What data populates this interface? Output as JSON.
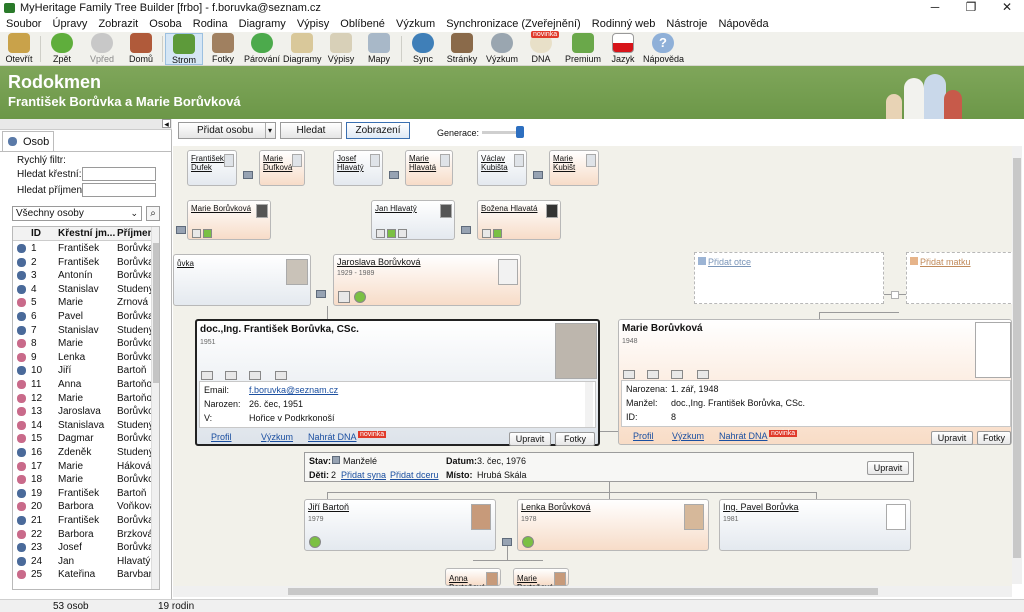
{
  "window": {
    "title": "MyHeritage Family Tree Builder [frbo] - f.boruvka@seznam.cz",
    "min": "─",
    "max": "❐",
    "close": "✕"
  },
  "menu": [
    "Soubor",
    "Úpravy",
    "Zobrazit",
    "Osoba",
    "Rodina",
    "Diagramy",
    "Výpisy",
    "Oblíbené",
    "Výzkum",
    "Synchronizace (Zveřejnění)",
    "Rodinný web",
    "Nástroje",
    "Nápověda"
  ],
  "toolbar": {
    "otevrit": "Otevřít",
    "zpet": "Zpět",
    "vpred": "Vpřed",
    "domu": "Domů",
    "strom": "Strom",
    "fotky": "Fotky",
    "parovani": "Párování",
    "diagramy": "Diagramy",
    "vypisy": "Výpisy",
    "mapy": "Mapy",
    "sync": "Sync",
    "stranky": "Stránky",
    "vyzkum": "Výzkum",
    "dna": "DNA",
    "novinka": "novinka",
    "premium": "Premium",
    "jazyk": "Jazyk",
    "napoveda": "Nápověda"
  },
  "header": {
    "title": "Rodokmen",
    "subtitle": "František Borůvka a Marie Borůvková"
  },
  "view": {
    "add_person": "Přidat osobu",
    "search": "Hledat",
    "display": "Zobrazení",
    "generations": "Generace:"
  },
  "left": {
    "tab": "Osob",
    "quick_filter": "Rychlý filtr:",
    "first_name": "Hledat křestní:",
    "last_name": "Hledat příjmení:",
    "all_persons": "Všechny osoby",
    "col_id": "ID",
    "col_first": "Křestní jm...",
    "col_last": "Příjmení"
  },
  "persons": [
    {
      "id": "1",
      "first": "František",
      "last": "Borůvka",
      "g": "m"
    },
    {
      "id": "2",
      "first": "František",
      "last": "Borůvka",
      "g": "m"
    },
    {
      "id": "3",
      "first": "Antonín",
      "last": "Borůvka",
      "g": "m"
    },
    {
      "id": "4",
      "first": "Stanislav",
      "last": "Studený",
      "g": "m"
    },
    {
      "id": "5",
      "first": "Marie",
      "last": "Zrnová",
      "g": "f"
    },
    {
      "id": "6",
      "first": "Pavel",
      "last": "Borůvka",
      "g": "m"
    },
    {
      "id": "7",
      "first": "Stanislav",
      "last": "Studený",
      "g": "m"
    },
    {
      "id": "8",
      "first": "Marie",
      "last": "Borůvkov",
      "g": "f"
    },
    {
      "id": "9",
      "first": "Lenka",
      "last": "Borůvkov",
      "g": "f"
    },
    {
      "id": "10",
      "first": "Jiří",
      "last": "Bartoň",
      "g": "m"
    },
    {
      "id": "11",
      "first": "Anna",
      "last": "Bartoňov",
      "g": "f"
    },
    {
      "id": "12",
      "first": "Marie",
      "last": "Bartoňov",
      "g": "f"
    },
    {
      "id": "13",
      "first": "Jaroslava",
      "last": "Borůvkov",
      "g": "f"
    },
    {
      "id": "14",
      "first": "Stanislava",
      "last": "Studený",
      "g": "f"
    },
    {
      "id": "15",
      "first": "Dagmar",
      "last": "Borůvkov",
      "g": "f"
    },
    {
      "id": "16",
      "first": "Zdeněk",
      "last": "Studený",
      "g": "m"
    },
    {
      "id": "17",
      "first": "Marie",
      "last": "Háková",
      "g": "f"
    },
    {
      "id": "18",
      "first": "Marie",
      "last": "Borůvkov",
      "g": "f"
    },
    {
      "id": "19",
      "first": "František",
      "last": "Bartoň",
      "g": "m"
    },
    {
      "id": "20",
      "first": "Barbora",
      "last": "Voňková",
      "g": "f"
    },
    {
      "id": "21",
      "first": "František",
      "last": "Borůvka",
      "g": "m"
    },
    {
      "id": "22",
      "first": "Barbora",
      "last": "Brzková",
      "g": "f"
    },
    {
      "id": "23",
      "first": "Josef",
      "last": "Borůvka",
      "g": "m"
    },
    {
      "id": "24",
      "first": "Jan",
      "last": "Hlavatý",
      "g": "m"
    },
    {
      "id": "25",
      "first": "Kateřina",
      "last": "Barvbar",
      "g": "f"
    }
  ],
  "tree": {
    "gg": [
      "František Dufek",
      "Marie Dufková",
      "Josef Hlavatý",
      "Marie Hlavatá",
      "Václav Kubišta",
      "Marie Kubišt"
    ],
    "gp": [
      "Marie Borůvková",
      "Jan Hlavatý",
      "Božena Hlavatá"
    ],
    "parent_left": "ůvka",
    "mother": {
      "name": "Jaroslava Borůvková",
      "years": "1929 - 1989"
    },
    "add_father": "Přidat otce",
    "add_mother": "Přidat matku",
    "main": {
      "name": "doc.,Ing. František Borůvka, CSc.",
      "year": "1951",
      "email_lbl": "Email:",
      "email": "f.boruvka@seznam.cz",
      "born_lbl": "Narozen:",
      "born": "26. čec, 1951",
      "v_lbl": "V:",
      "v": "Hořice v Podkrkonoší",
      "profile": "Profil",
      "research": "Výzkum",
      "dna": "Nahrát DNA",
      "novinka": "novinka",
      "edit": "Upravit",
      "photos": "Fotky"
    },
    "spouse": {
      "name": "Marie Borůvková",
      "year": "1948",
      "born_lbl": "Narozena:",
      "born": "1. zář, 1948",
      "husband_lbl": "Manžel:",
      "husband": "doc.,Ing. František Borůvka, CSc.",
      "id_lbl": "ID:",
      "id": "8",
      "profile": "Profil",
      "research": "Výzkum",
      "dna": "Nahrát DNA",
      "novinka": "novinka",
      "edit": "Upravit",
      "photos": "Fotky"
    },
    "family": {
      "stav_lbl": "Stav:",
      "stav": "Manželé",
      "datum_lbl": "Datum:",
      "datum": "3. čec, 1976",
      "deti_lbl": "Děti:",
      "deti": "2",
      "add_son": "Přidat syna",
      "add_daughter": "Přidat dceru",
      "misto_lbl": "Místo:",
      "misto": "Hrubá Skála",
      "edit": "Upravit"
    },
    "children": [
      {
        "name": "Jiří Bartoň",
        "year": "1979"
      },
      {
        "name": "Lenka Borůvková",
        "year": "1978"
      },
      {
        "name": "Ing. Pavel Borůvka",
        "year": "1981"
      }
    ],
    "grandchildren": [
      "Anna Bartoňová",
      "Marie Bartoňová"
    ]
  },
  "status": {
    "persons": "53 osob",
    "families": "19 rodin"
  },
  "colors": {
    "header": "#6f9a4b",
    "accent": "#1b4fa0",
    "male": "#e4e9ef",
    "female": "#f7dcc8"
  }
}
